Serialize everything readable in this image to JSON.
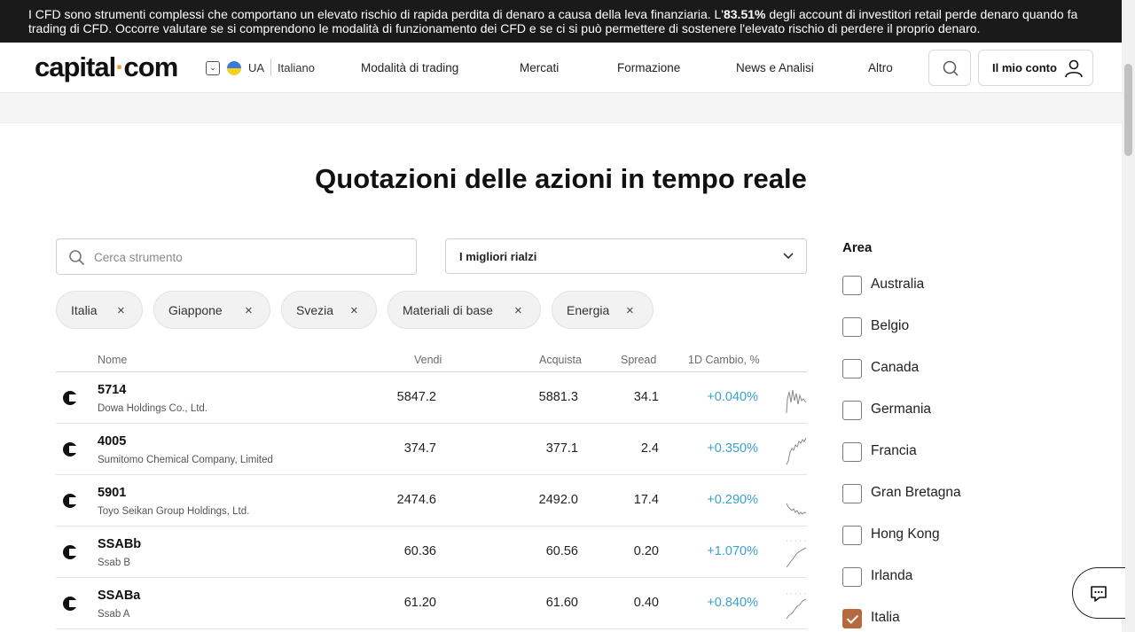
{
  "risk_banner": {
    "text_before": "I CFD sono strumenti complessi che comportano un elevato rischio di rapida perdita di denaro a causa della leva finanziaria. L'",
    "percent": "83.51%",
    "text_after": " degli account di investitori retail perde denaro quando fa trading di CFD. Occorre valutare se si comprendono le modalità di funzionamento dei CFD e se ci si può permettere di sostenere l'elevato rischio di perdere il proprio denaro."
  },
  "header": {
    "logo_left": "capital",
    "logo_dot": "·",
    "logo_right": "com",
    "lang_code": "UA",
    "lang_name": "Italiano",
    "nav": [
      "Modalità di trading",
      "Mercati",
      "Formazione",
      "News e Analisi",
      "Altro"
    ],
    "account_label": "Il mio conto"
  },
  "page_title": "Quotazioni delle azioni in tempo reale",
  "search": {
    "placeholder": "Cerca strumento"
  },
  "sort": {
    "selected": "I migliori rialzi"
  },
  "chips": [
    "Italia",
    "Giappone",
    "Svezia",
    "Materiali di base",
    "Energia"
  ],
  "table": {
    "headers": {
      "name": "Nome",
      "sell": "Vendi",
      "buy": "Acquista",
      "spread": "Spread",
      "change": "1D Cambio, %"
    },
    "rows": [
      {
        "symbol": "5714",
        "name": "Dowa Holdings Co., Ltd.",
        "sell": "5847.2",
        "buy": "5881.3",
        "spread": "34.1",
        "change": "+0.040%"
      },
      {
        "symbol": "4005",
        "name": "Sumitomo Chemical Company, Limited",
        "sell": "374.7",
        "buy": "377.1",
        "spread": "2.4",
        "change": "+0.350%"
      },
      {
        "symbol": "5901",
        "name": "Toyo Seikan Group Holdings, Ltd.",
        "sell": "2474.6",
        "buy": "2492.0",
        "spread": "17.4",
        "change": "+0.290%"
      },
      {
        "symbol": "SSABb",
        "name": "Ssab B",
        "sell": "60.36",
        "buy": "60.56",
        "spread": "0.20",
        "change": "+1.070%"
      },
      {
        "symbol": "SSABa",
        "name": "Ssab A",
        "sell": "61.20",
        "buy": "61.60",
        "spread": "0.40",
        "change": "+0.840%"
      }
    ]
  },
  "filters": {
    "title": "Area",
    "items": [
      {
        "label": "Australia",
        "checked": false
      },
      {
        "label": "Belgio",
        "checked": false
      },
      {
        "label": "Canada",
        "checked": false
      },
      {
        "label": "Germania",
        "checked": false
      },
      {
        "label": "Francia",
        "checked": false
      },
      {
        "label": "Gran Bretagna",
        "checked": false
      },
      {
        "label": "Hong Kong",
        "checked": false
      },
      {
        "label": "Irlanda",
        "checked": false
      },
      {
        "label": "Italia",
        "checked": true
      }
    ]
  },
  "colors": {
    "accent_checkbox": "#b5693f",
    "positive_change": "#3aa0cf",
    "banner_bg": "#1a1a1a",
    "logo_dot": "#e8a33d"
  },
  "icons": [
    "chevron-down-icon",
    "search-icon",
    "user-icon",
    "close-icon",
    "chat-icon",
    "capital-logo-icon",
    "sparkline-icon"
  ]
}
